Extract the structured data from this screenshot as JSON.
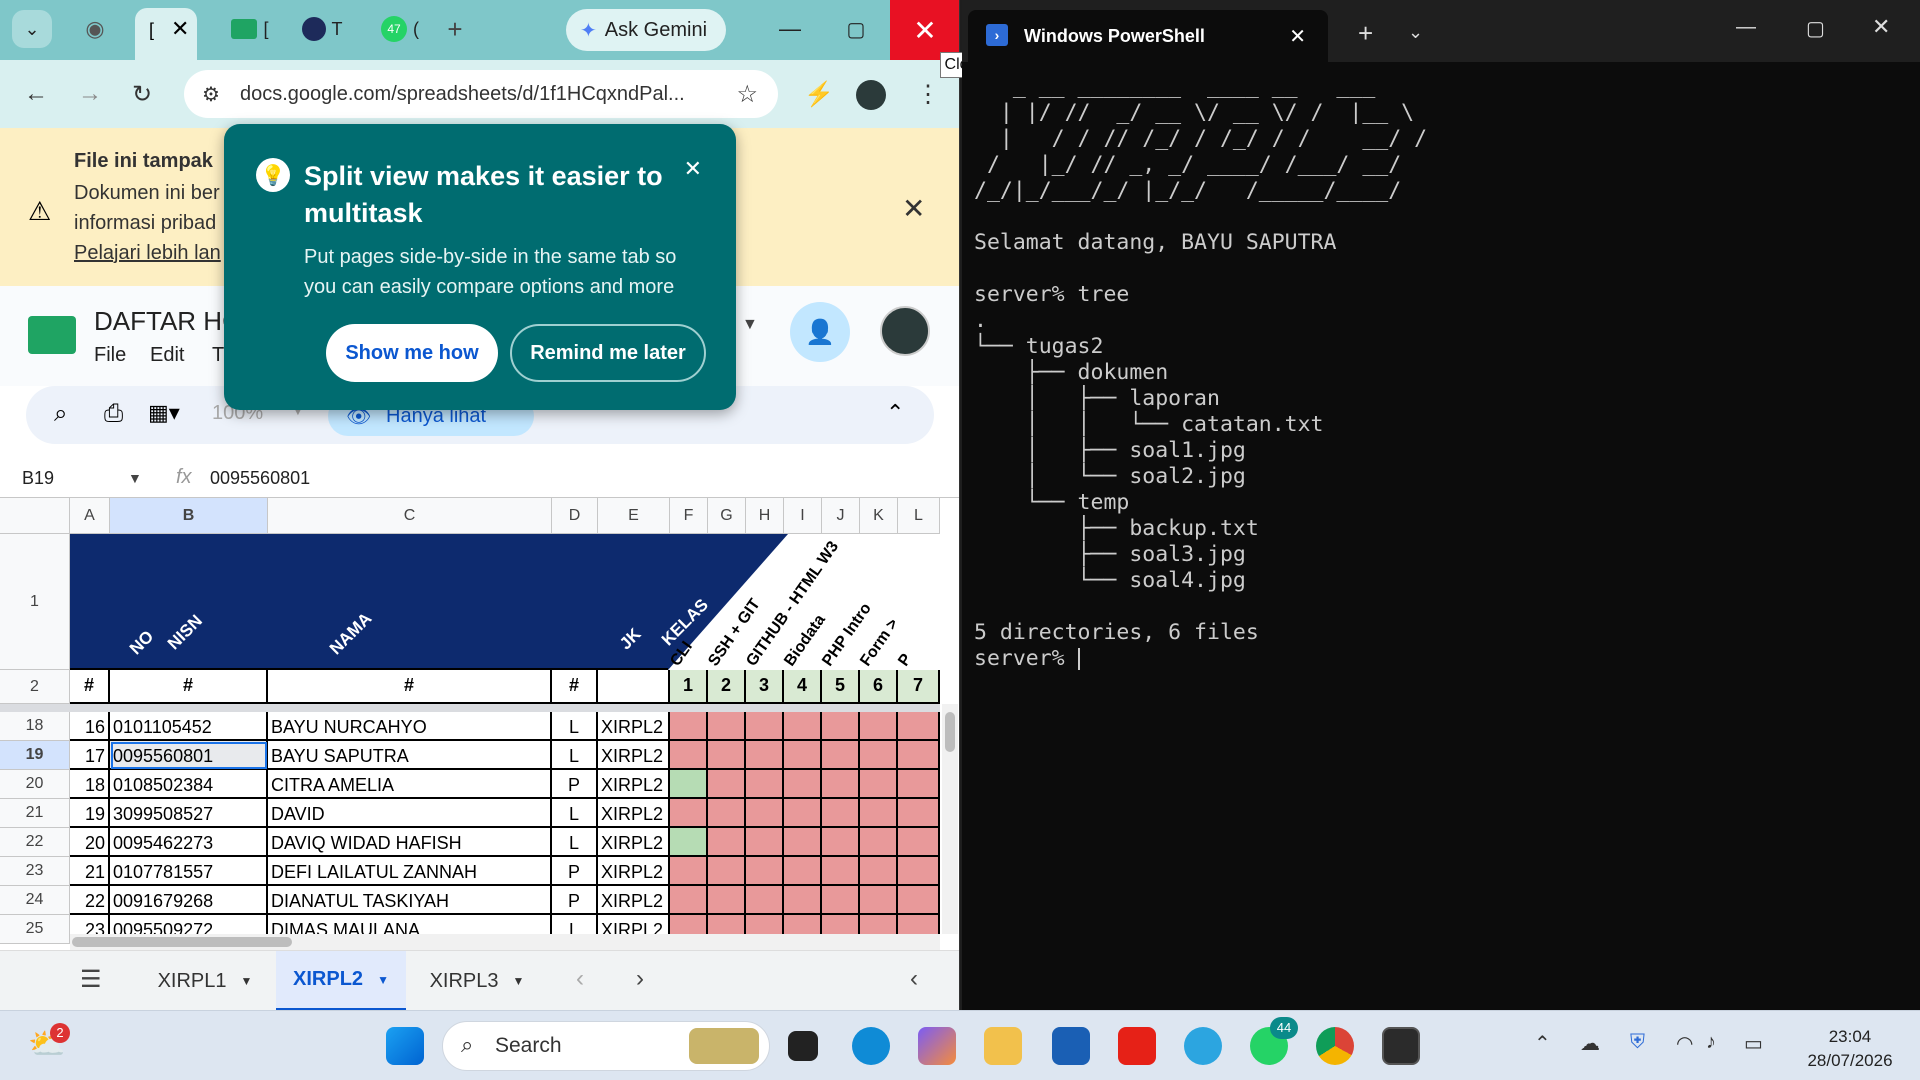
{
  "browser": {
    "tabs": [
      "[",
      "[",
      "T",
      "("
    ],
    "tab_counter": "47",
    "gemini_label": "Ask Gemini",
    "close_tooltip": "Close",
    "url": "docs.google.com/spreadsheets/d/1f1HCqxndPal..."
  },
  "banner": {
    "title": "File ini tampak",
    "lines": [
      "Dokumen ini ber",
      "informasi pribad"
    ],
    "link": "Pelajari lebih lan"
  },
  "popup": {
    "title": "Split view makes it easier to multitask",
    "body": "Put pages side-by-side in the same tab so you can easily compare options and more",
    "show_btn": "Show me how",
    "remind_btn": "Remind me later"
  },
  "sheet": {
    "title": "DAFTAR HC",
    "menu": [
      "File",
      "Edit",
      "T"
    ],
    "zoom": "100%",
    "view_mode": "Hanya lihat",
    "cell_ref": "B19",
    "formula_value": "0095560801",
    "columns": [
      "A",
      "B",
      "C",
      "D",
      "E",
      "F",
      "G",
      "H",
      "I",
      "J",
      "K",
      "L"
    ],
    "header_labels": {
      "no": "NO",
      "nisn": "NISN",
      "nama": "NAMA",
      "jk": "JK",
      "kelas": "KELAS"
    },
    "task_labels": [
      "CLI",
      "SSH + GIT",
      "GITHUB - HTML W3",
      "Biodata",
      "PHP Intro",
      "Form >",
      "P"
    ],
    "task_numbers": [
      "1",
      "2",
      "3",
      "4",
      "5",
      "6",
      "7"
    ],
    "hash": "#",
    "header_rows": [
      "1",
      "2"
    ],
    "rows": [
      {
        "r": "18",
        "no": "16",
        "nisn": "0101105452",
        "nama": "BAYU NURCAHYO",
        "jk": "L",
        "kelas": "XIRPL2",
        "status": [
          "p",
          "p",
          "p",
          "p",
          "p",
          "p",
          "p"
        ]
      },
      {
        "r": "19",
        "no": "17",
        "nisn": "0095560801",
        "nama": "BAYU SAPUTRA",
        "jk": "L",
        "kelas": "XIRPL2",
        "status": [
          "p",
          "p",
          "p",
          "p",
          "p",
          "p",
          "p"
        ]
      },
      {
        "r": "20",
        "no": "18",
        "nisn": "0108502384",
        "nama": "CITRA AMELIA",
        "jk": "P",
        "kelas": "XIRPL2",
        "status": [
          "g",
          "p",
          "p",
          "p",
          "p",
          "p",
          "p"
        ]
      },
      {
        "r": "21",
        "no": "19",
        "nisn": "3099508527",
        "nama": "DAVID",
        "jk": "L",
        "kelas": "XIRPL2",
        "status": [
          "p",
          "p",
          "p",
          "p",
          "p",
          "p",
          "p"
        ]
      },
      {
        "r": "22",
        "no": "20",
        "nisn": "0095462273",
        "nama": "DAVIQ WIDAD HAFISH",
        "jk": "L",
        "kelas": "XIRPL2",
        "status": [
          "g",
          "p",
          "p",
          "p",
          "p",
          "p",
          "p"
        ]
      },
      {
        "r": "23",
        "no": "21",
        "nisn": "0107781557",
        "nama": "DEFI LAILATUL ZANNAH",
        "jk": "P",
        "kelas": "XIRPL2",
        "status": [
          "p",
          "p",
          "p",
          "p",
          "p",
          "p",
          "p"
        ]
      },
      {
        "r": "24",
        "no": "22",
        "nisn": "0091679268",
        "nama": "DIANATUL TASKIYAH",
        "jk": "P",
        "kelas": "XIRPL2",
        "status": [
          "p",
          "p",
          "p",
          "p",
          "p",
          "p",
          "p"
        ]
      },
      {
        "r": "25",
        "no": "23",
        "nisn": "0095509272",
        "nama": "DIMAS MAULANA",
        "jk": "L",
        "kelas": "XIRPL2",
        "status": [
          "p",
          "p",
          "p",
          "p",
          "p",
          "p",
          "p"
        ]
      }
    ],
    "sheet_tabs": [
      "XIRPL1",
      "XIRPL2",
      "XIRPL3"
    ],
    "active_tab": "XIRPL2",
    "colors": {
      "header_navy": "#0d2a6e",
      "pending": "#e8999a",
      "done": "#b6dcb4"
    }
  },
  "terminal": {
    "tab_title": "Windows PowerShell",
    "lines": [
      "   _ __ ________  ____ __   ___",
      "  | |/ //  _/ __ \\/ __ \\/ /  |__ \\",
      "  |   / / // /_/ / /_/ / /    __/ /",
      " /   |_/ // _, _/ ____/ /___/ __/",
      "/_/|_/___/_/ |_/_/   /_____/____/",
      "",
      "Selamat datang, BAYU SAPUTRA",
      "",
      "server% tree",
      ".",
      "└── tugas2",
      "    ├── dokumen",
      "    │   ├── laporan",
      "    │   │   └── catatan.txt",
      "    │   ├── soal1.jpg",
      "    │   └── soal2.jpg",
      "    └── temp",
      "        ├── backup.txt",
      "        ├── soal3.jpg",
      "        └── soal4.jpg",
      "",
      "5 directories, 6 files",
      "server% "
    ]
  },
  "taskbar": {
    "search_placeholder": "Search",
    "weather_badge": "2",
    "whatsapp_badge": "44",
    "time": "23:04",
    "date": "28/07/2026"
  }
}
